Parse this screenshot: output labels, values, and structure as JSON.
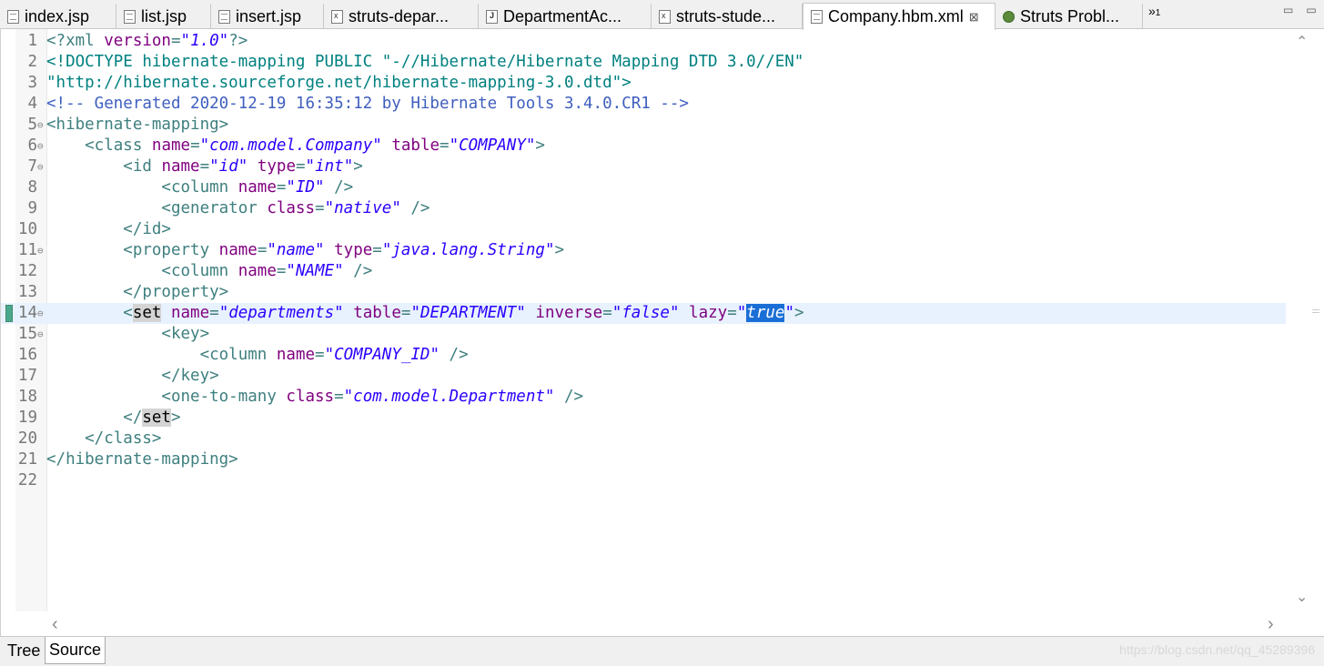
{
  "tabs": [
    {
      "label": "index.jsp",
      "icon": "jsp-file-icon",
      "active": false
    },
    {
      "label": "list.jsp",
      "icon": "jsp-file-icon",
      "active": false
    },
    {
      "label": "insert.jsp",
      "icon": "jsp-file-icon",
      "active": false
    },
    {
      "label": "struts-depar...",
      "icon": "xml-file-icon",
      "active": false
    },
    {
      "label": "DepartmentAc...",
      "icon": "java-file-icon",
      "active": false
    },
    {
      "label": "struts-stude...",
      "icon": "xml-file-icon",
      "active": false
    },
    {
      "label": "Company.hbm.xml",
      "icon": "hbm-file-icon",
      "active": true
    },
    {
      "label": "Struts Probl...",
      "icon": "globe-icon",
      "active": false
    }
  ],
  "overflow": {
    "symbol": "»",
    "count": "1"
  },
  "close_symbol": "⊠",
  "lines": [
    {
      "n": "1",
      "fold": "",
      "parts": [
        [
          "pi",
          "<?xml "
        ],
        [
          "attr",
          "version"
        ],
        [
          "pi",
          "="
        ],
        [
          "val",
          "\"1.0\""
        ],
        [
          "pi",
          "?>"
        ]
      ]
    },
    {
      "n": "2",
      "fold": "",
      "parts": [
        [
          "doc",
          "<!DOCTYPE hibernate-mapping PUBLIC \"-//Hibernate/Hibernate Mapping DTD 3.0//EN\""
        ]
      ]
    },
    {
      "n": "3",
      "fold": "",
      "parts": [
        [
          "doc",
          "\"http://hibernate.sourceforge.net/hibernate-mapping-3.0.dtd\">"
        ]
      ]
    },
    {
      "n": "4",
      "fold": "",
      "parts": [
        [
          "com",
          "<!-- Generated 2020-12-19 16:35:12 by Hibernate Tools 3.4.0.CR1 -->"
        ]
      ]
    },
    {
      "n": "5",
      "fold": "⊖",
      "parts": [
        [
          "tag",
          "<hibernate-mapping>"
        ]
      ]
    },
    {
      "n": "6",
      "fold": "⊖",
      "parts": [
        [
          "tag",
          "    <class "
        ],
        [
          "attr",
          "name"
        ],
        [
          "tag",
          "="
        ],
        [
          "val",
          "\"com.model.Company\""
        ],
        [
          "tag",
          " "
        ],
        [
          "attr",
          "table"
        ],
        [
          "tag",
          "="
        ],
        [
          "val",
          "\"COMPANY\""
        ],
        [
          "tag",
          ">"
        ]
      ]
    },
    {
      "n": "7",
      "fold": "⊖",
      "parts": [
        [
          "tag",
          "        <id "
        ],
        [
          "attr",
          "name"
        ],
        [
          "tag",
          "="
        ],
        [
          "val",
          "\"id\""
        ],
        [
          "tag",
          " "
        ],
        [
          "attr",
          "type"
        ],
        [
          "tag",
          "="
        ],
        [
          "val",
          "\"int\""
        ],
        [
          "tag",
          ">"
        ]
      ]
    },
    {
      "n": "8",
      "fold": "",
      "parts": [
        [
          "tag",
          "            <column "
        ],
        [
          "attr",
          "name"
        ],
        [
          "tag",
          "="
        ],
        [
          "val",
          "\"ID\""
        ],
        [
          "tag",
          " />"
        ]
      ]
    },
    {
      "n": "9",
      "fold": "",
      "parts": [
        [
          "tag",
          "            <generator "
        ],
        [
          "attr",
          "class"
        ],
        [
          "tag",
          "="
        ],
        [
          "val",
          "\"native\""
        ],
        [
          "tag",
          " />"
        ]
      ]
    },
    {
      "n": "10",
      "fold": "",
      "parts": [
        [
          "tag",
          "        </id>"
        ]
      ]
    },
    {
      "n": "11",
      "fold": "⊖",
      "parts": [
        [
          "tag",
          "        <property "
        ],
        [
          "attr",
          "name"
        ],
        [
          "tag",
          "="
        ],
        [
          "val",
          "\"name\""
        ],
        [
          "tag",
          " "
        ],
        [
          "attr",
          "type"
        ],
        [
          "tag",
          "="
        ],
        [
          "val",
          "\"java.lang.String\""
        ],
        [
          "tag",
          ">"
        ]
      ]
    },
    {
      "n": "12",
      "fold": "",
      "parts": [
        [
          "tag",
          "            <column "
        ],
        [
          "attr",
          "name"
        ],
        [
          "tag",
          "="
        ],
        [
          "val",
          "\"NAME\""
        ],
        [
          "tag",
          " />"
        ]
      ]
    },
    {
      "n": "13",
      "fold": "",
      "parts": [
        [
          "tag",
          "        </property>"
        ]
      ]
    },
    {
      "n": "14",
      "fold": "⊖",
      "current": true,
      "parts": [
        [
          "tag",
          "        <"
        ],
        [
          "match",
          "set"
        ],
        [
          "tag",
          " "
        ],
        [
          "attr",
          "name"
        ],
        [
          "tag",
          "="
        ],
        [
          "val",
          "\"departments\""
        ],
        [
          "tag",
          " "
        ],
        [
          "attr",
          "table"
        ],
        [
          "tag",
          "="
        ],
        [
          "val",
          "\"DEPARTMENT\""
        ],
        [
          "tag",
          " "
        ],
        [
          "attr",
          "inverse"
        ],
        [
          "tag",
          "="
        ],
        [
          "val",
          "\"false\""
        ],
        [
          "tag",
          " "
        ],
        [
          "attr",
          "lazy"
        ],
        [
          "tag",
          "="
        ],
        [
          "val",
          "\""
        ],
        [
          "sel",
          "true"
        ],
        [
          "val",
          "\""
        ],
        [
          "tag",
          ">"
        ]
      ]
    },
    {
      "n": "15",
      "fold": "⊖",
      "parts": [
        [
          "tag",
          "            <key>"
        ]
      ]
    },
    {
      "n": "16",
      "fold": "",
      "parts": [
        [
          "tag",
          "                <column "
        ],
        [
          "attr",
          "name"
        ],
        [
          "tag",
          "="
        ],
        [
          "val",
          "\"COMPANY_ID\""
        ],
        [
          "tag",
          " />"
        ]
      ]
    },
    {
      "n": "17",
      "fold": "",
      "parts": [
        [
          "tag",
          "            </key>"
        ]
      ]
    },
    {
      "n": "18",
      "fold": "",
      "parts": [
        [
          "tag",
          "            <one-to-many "
        ],
        [
          "attr",
          "class"
        ],
        [
          "tag",
          "="
        ],
        [
          "val",
          "\"com.model.Department\""
        ],
        [
          "tag",
          " />"
        ]
      ]
    },
    {
      "n": "19",
      "fold": "",
      "parts": [
        [
          "tag",
          "        </"
        ],
        [
          "match",
          "set"
        ],
        [
          "tag",
          ">"
        ]
      ]
    },
    {
      "n": "20",
      "fold": "",
      "parts": [
        [
          "tag",
          "    </class>"
        ]
      ]
    },
    {
      "n": "21",
      "fold": "",
      "parts": [
        [
          "tag",
          "</hibernate-mapping>"
        ]
      ]
    },
    {
      "n": "22",
      "fold": "",
      "parts": []
    }
  ],
  "bottom_tabs": [
    {
      "label": "Tree",
      "active": false
    },
    {
      "label": "Source",
      "active": true
    }
  ],
  "watermark": "https://blog.csdn.net/qq_45289396",
  "scroll": {
    "up": "⌃",
    "down": "⌄",
    "left": "‹",
    "right": "›"
  }
}
